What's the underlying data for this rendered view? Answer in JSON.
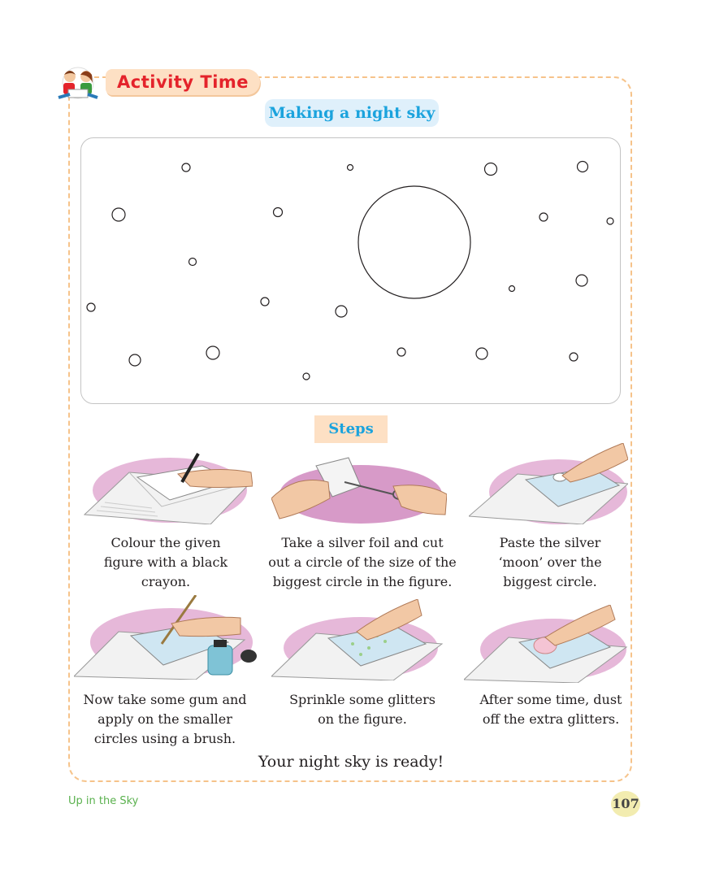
{
  "header": {
    "badge_label": "Activity Time",
    "activity_title": "Making a night sky"
  },
  "steps_heading": "Steps",
  "steps": [
    {
      "lines": [
        "Colour the given",
        "figure with a black",
        "crayon."
      ],
      "illustration": "hand-coloring-book-icon"
    },
    {
      "lines": [
        "Take a silver foil and cut",
        "out a circle of the size of the",
        "biggest circle in the figure."
      ],
      "illustration": "scissors-cutting-foil-icon"
    },
    {
      "lines": [
        "Paste the silver",
        "‘moon’ over the",
        "biggest circle."
      ],
      "illustration": "hand-pasting-moon-icon"
    },
    {
      "lines": [
        "Now take some gum and",
        "apply on the smaller",
        "circles using a brush."
      ],
      "illustration": "brush-and-gum-bottle-icon"
    },
    {
      "lines": [
        "Sprinkle some glitters",
        "on the figure."
      ],
      "illustration": "hand-sprinkling-glitter-icon"
    },
    {
      "lines": [
        "After some time, dust",
        "off the extra glitters."
      ],
      "illustration": "hand-dusting-glitter-icon"
    }
  ],
  "closing": "Your night sky is ready!",
  "footer": {
    "chapter": "Up in the Sky",
    "page_number": "107"
  },
  "colors": {
    "accent_red": "#e4232b",
    "accent_blue": "#1ba3dd",
    "pill_bg": "#fde0c4",
    "frame_dash": "#f6c38a",
    "footer_green": "#5ab14e"
  }
}
